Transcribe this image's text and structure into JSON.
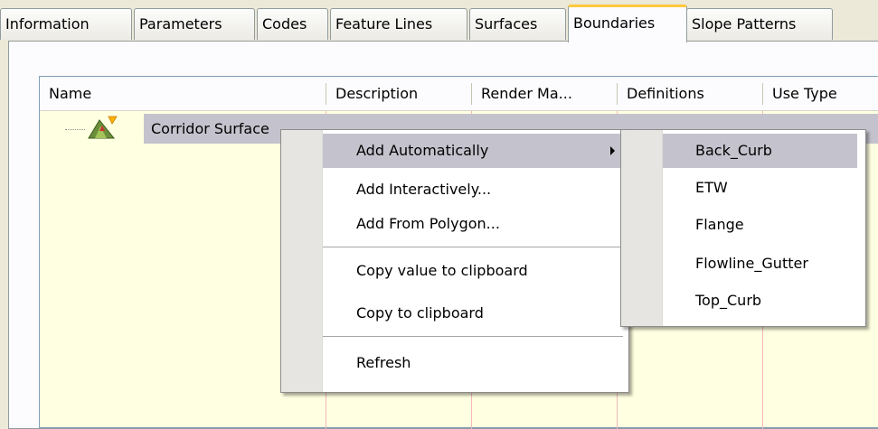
{
  "tabs": [
    {
      "label": "Information",
      "active": false
    },
    {
      "label": "Parameters",
      "active": false
    },
    {
      "label": "Codes",
      "active": false
    },
    {
      "label": "Feature Lines",
      "active": false
    },
    {
      "label": "Surfaces",
      "active": false
    },
    {
      "label": "Boundaries",
      "active": true
    },
    {
      "label": "Slope Patterns",
      "active": false
    }
  ],
  "columns": [
    "Name",
    "Description",
    "Render Ma...",
    "Definitions",
    "Use Type"
  ],
  "tree": {
    "row_label": "Corridor Surface",
    "icon": "corridor-surface-icon"
  },
  "context_menu": {
    "items": [
      "Add Automatically",
      "Add Interactively...",
      "Add From Polygon...",
      "Copy value to clipboard",
      "Copy to clipboard",
      "Refresh"
    ],
    "highlighted": "Add Automatically"
  },
  "submenu": {
    "items": [
      "Back_Curb",
      "ETW",
      "Flange",
      "Flowline_Gutter",
      "Top_Curb"
    ],
    "highlighted": "Back_Curb"
  },
  "colors": {
    "highlight": "#c4c3cd",
    "active_tab_accent": "#ffc83c",
    "list_background": "#ffffe1",
    "dialog_background": "#ece9d8"
  }
}
